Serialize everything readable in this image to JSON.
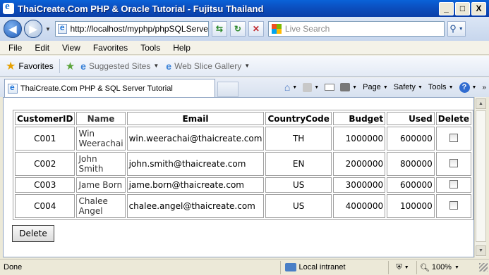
{
  "window": {
    "title": "ThaiCreate.Com PHP & Oracle Tutorial - Fujitsu Thailand",
    "minimize": "_",
    "maximize": "□",
    "close": "X"
  },
  "addressbar": {
    "back_icon": "back-arrow-icon",
    "forward_icon": "forward-arrow-icon",
    "url": "http://localhost/myphp/phpSQLServe",
    "search_placeholder": "Live Search",
    "search_icon": "magnifier-icon"
  },
  "menu": [
    "File",
    "Edit",
    "View",
    "Favorites",
    "Tools",
    "Help"
  ],
  "favorites": {
    "label": "Favorites",
    "items": [
      "Suggested Sites",
      "Web Slice Gallery"
    ]
  },
  "tab": {
    "title": "ThaiCreate.Com PHP & SQL Server Tutorial"
  },
  "commands": {
    "page": "Page",
    "safety": "Safety",
    "tools": "Tools"
  },
  "table": {
    "headers": [
      "CustomerID",
      "Name",
      "Email",
      "CountryCode",
      "Budget",
      "Used",
      "Delete"
    ],
    "rows": [
      {
        "id": "C001",
        "name": "Win Weerachai",
        "email": "win.weerachai@thaicreate.com",
        "country": "TH",
        "budget": "1000000",
        "used": "600000"
      },
      {
        "id": "C002",
        "name": "John Smith",
        "email": "john.smith@thaicreate.com",
        "country": "EN",
        "budget": "2000000",
        "used": "800000"
      },
      {
        "id": "C003",
        "name": "Jame Born",
        "email": "jame.born@thaicreate.com",
        "country": "US",
        "budget": "3000000",
        "used": "600000"
      },
      {
        "id": "C004",
        "name": "Chalee Angel",
        "email": "chalee.angel@thaicreate.com",
        "country": "US",
        "budget": "4000000",
        "used": "100000"
      }
    ]
  },
  "delete_button": "Delete",
  "status": {
    "text": "Done",
    "zone": "Local intranet",
    "zoom": "100%"
  }
}
